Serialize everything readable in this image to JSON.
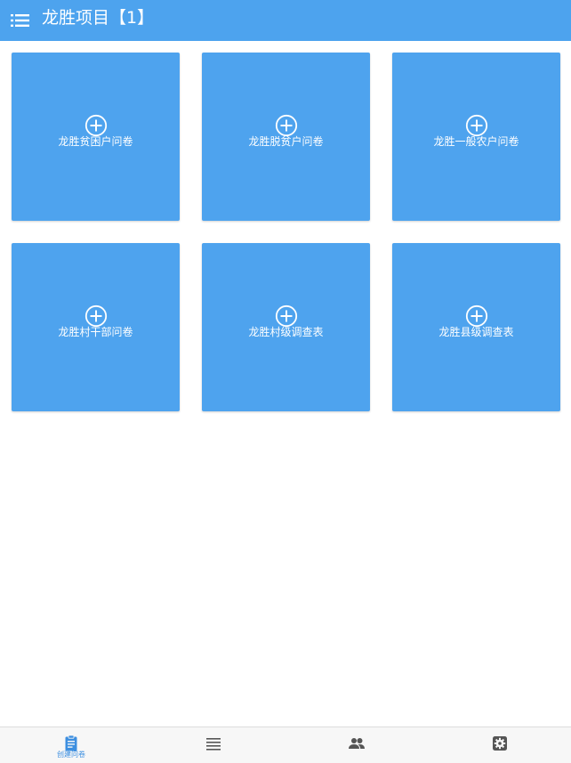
{
  "header": {
    "title": "龙胜项目【1】",
    "menu_icon": "list-menu-icon",
    "background_color": "#4da3ee"
  },
  "cards": [
    {
      "label": "龙胜贫困户问卷",
      "icon": "add-circle-icon"
    },
    {
      "label": "龙胜脱贫户问卷",
      "icon": "add-circle-icon"
    },
    {
      "label": "龙胜一般农户问卷",
      "icon": "add-circle-icon"
    },
    {
      "label": "龙胜村干部问卷",
      "icon": "add-circle-icon"
    },
    {
      "label": "龙胜村级调查表",
      "icon": "add-circle-icon"
    },
    {
      "label": "龙胜县级调查表",
      "icon": "add-circle-icon"
    }
  ],
  "card_color": "#4ea3ee",
  "tabbar": {
    "tabs": [
      {
        "label": "创建问卷",
        "icon": "clipboard-icon",
        "active": true
      },
      {
        "label": "",
        "icon": "list-icon",
        "active": false
      },
      {
        "label": "",
        "icon": "people-icon",
        "active": false
      },
      {
        "label": "",
        "icon": "settings-gear-icon",
        "active": false
      }
    ],
    "active_color": "#3d8fe0",
    "inactive_color": "#555555"
  }
}
